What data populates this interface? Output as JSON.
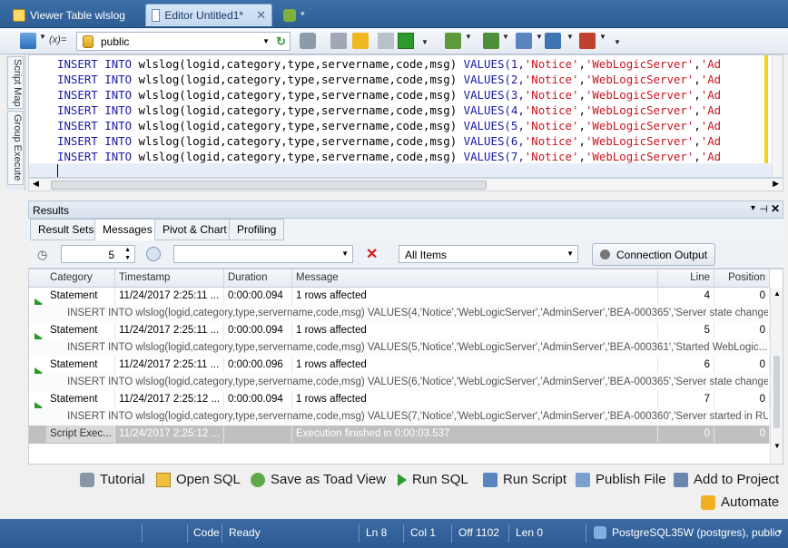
{
  "tabs": [
    {
      "label": "Viewer Table wlslog"
    },
    {
      "label": "Editor Untitled1*"
    },
    {
      "label": "*"
    }
  ],
  "toolbar": {
    "schema": "public",
    "var_label": "(x)="
  },
  "sidebar": {
    "script_map": "Script Map",
    "group_execute": "Group Execute"
  },
  "editor": {
    "lines": [
      {
        "kw1": "INSERT",
        "kw2": "INTO",
        "table": "wlslog(logid,category,type,servername,code,msg)",
        "kw3": "VALUES(1,",
        "s1": "'Notice'",
        "c1": ",",
        "s2": "'WebLogicServer'",
        "c2": ",",
        "s3": "'Ad"
      },
      {
        "kw1": "INSERT",
        "kw2": "INTO",
        "table": "wlslog(logid,category,type,servername,code,msg)",
        "kw3": "VALUES(2,",
        "s1": "'Notice'",
        "c1": ",",
        "s2": "'WebLogicServer'",
        "c2": ",",
        "s3": "'Ad"
      },
      {
        "kw1": "INSERT",
        "kw2": "INTO",
        "table": "wlslog(logid,category,type,servername,code,msg)",
        "kw3": "VALUES(3,",
        "s1": "'Notice'",
        "c1": ",",
        "s2": "'WebLogicServer'",
        "c2": ",",
        "s3": "'Ad"
      },
      {
        "kw1": "INSERT",
        "kw2": "INTO",
        "table": "wlslog(logid,category,type,servername,code,msg)",
        "kw3": "VALUES(4,",
        "s1": "'Notice'",
        "c1": ",",
        "s2": "'WebLogicServer'",
        "c2": ",",
        "s3": "'Ad"
      },
      {
        "kw1": "INSERT",
        "kw2": "INTO",
        "table": "wlslog(logid,category,type,servername,code,msg)",
        "kw3": "VALUES(5,",
        "s1": "'Notice'",
        "c1": ",",
        "s2": "'WebLogicServer'",
        "c2": ",",
        "s3": "'Ad"
      },
      {
        "kw1": "INSERT",
        "kw2": "INTO",
        "table": "wlslog(logid,category,type,servername,code,msg)",
        "kw3": "VALUES(6,",
        "s1": "'Notice'",
        "c1": ",",
        "s2": "'WebLogicServer'",
        "c2": ",",
        "s3": "'Ad"
      },
      {
        "kw1": "INSERT",
        "kw2": "INTO",
        "table": "wlslog(logid,category,type,servername,code,msg)",
        "kw3": "VALUES(7,",
        "s1": "'Notice'",
        "c1": ",",
        "s2": "'WebLogicServer'",
        "c2": ",",
        "s3": "'Ad"
      }
    ]
  },
  "results": {
    "title": "Results",
    "tabs": [
      "Result Sets",
      "Messages",
      "Pivot & Chart",
      "Profiling"
    ],
    "active_tab": "Messages",
    "spin_value": "5",
    "filter_combo": "",
    "items_combo": "All Items",
    "connection_output": "Connection Output"
  },
  "grid": {
    "headers": [
      "Category",
      "Timestamp",
      "Duration",
      "Message",
      "Line",
      "Position"
    ],
    "rows": [
      {
        "category": "Statement",
        "timestamp": "11/24/2017 2:25:11 ...",
        "duration": "0:00:00.094",
        "message": "1 rows affected",
        "line": "4",
        "position": "0",
        "sql": "INSERT INTO wlslog(logid,category,type,servername,code,msg) VALUES(4,'Notice','WebLogicServer','AdminServer','BEA-000365','Server state changed to..."
      },
      {
        "category": "Statement",
        "timestamp": "11/24/2017 2:25:11 ...",
        "duration": "0:00:00.094",
        "message": "1 rows affected",
        "line": "5",
        "position": "0",
        "sql": "INSERT INTO wlslog(logid,category,type,servername,code,msg) VALUES(5,'Notice','WebLogicServer','AdminServer','BEA-000361','Started WebLogic..."
      },
      {
        "category": "Statement",
        "timestamp": "11/24/2017 2:25:11 ...",
        "duration": "0:00:00.096",
        "message": "1 rows affected",
        "line": "6",
        "position": "0",
        "sql": "INSERT INTO wlslog(logid,category,type,servername,code,msg) VALUES(6,'Notice','WebLogicServer','AdminServer','BEA-000365','Server state changed to..."
      },
      {
        "category": "Statement",
        "timestamp": "11/24/2017 2:25:12 ...",
        "duration": "0:00:00.094",
        "message": "1 rows affected",
        "line": "7",
        "position": "0",
        "sql": "INSERT INTO wlslog(logid,category,type,servername,code,msg) VALUES(7,'Notice','WebLogicServer','AdminServer','BEA-000360','Server started in RUNNING..."
      }
    ],
    "final": {
      "category": "Script Exec...",
      "timestamp": "11/24/2017 2:25:12 ...",
      "message": "Execution finished in 0:00:03.537",
      "line": "0",
      "position": "0"
    }
  },
  "actions": {
    "tutorial": "Tutorial",
    "open_sql": "Open SQL",
    "save_toad": "Save as Toad View",
    "run_sql": "Run SQL",
    "run_script": "Run Script",
    "publish_file": "Publish File",
    "add_project": "Add to Project",
    "automate": "Automate"
  },
  "status": {
    "code": "Code",
    "ready": "Ready",
    "ln": "Ln 8",
    "col": "Col 1",
    "off": "Off 1102",
    "len": "Len 0",
    "connection": "PostgreSQL35W (postgres), public"
  },
  "colors": {
    "accent": "#2d5d94",
    "keyword": "#1a1aa6",
    "string": "#c8141e",
    "run_arrow": "#2a9a2a"
  }
}
